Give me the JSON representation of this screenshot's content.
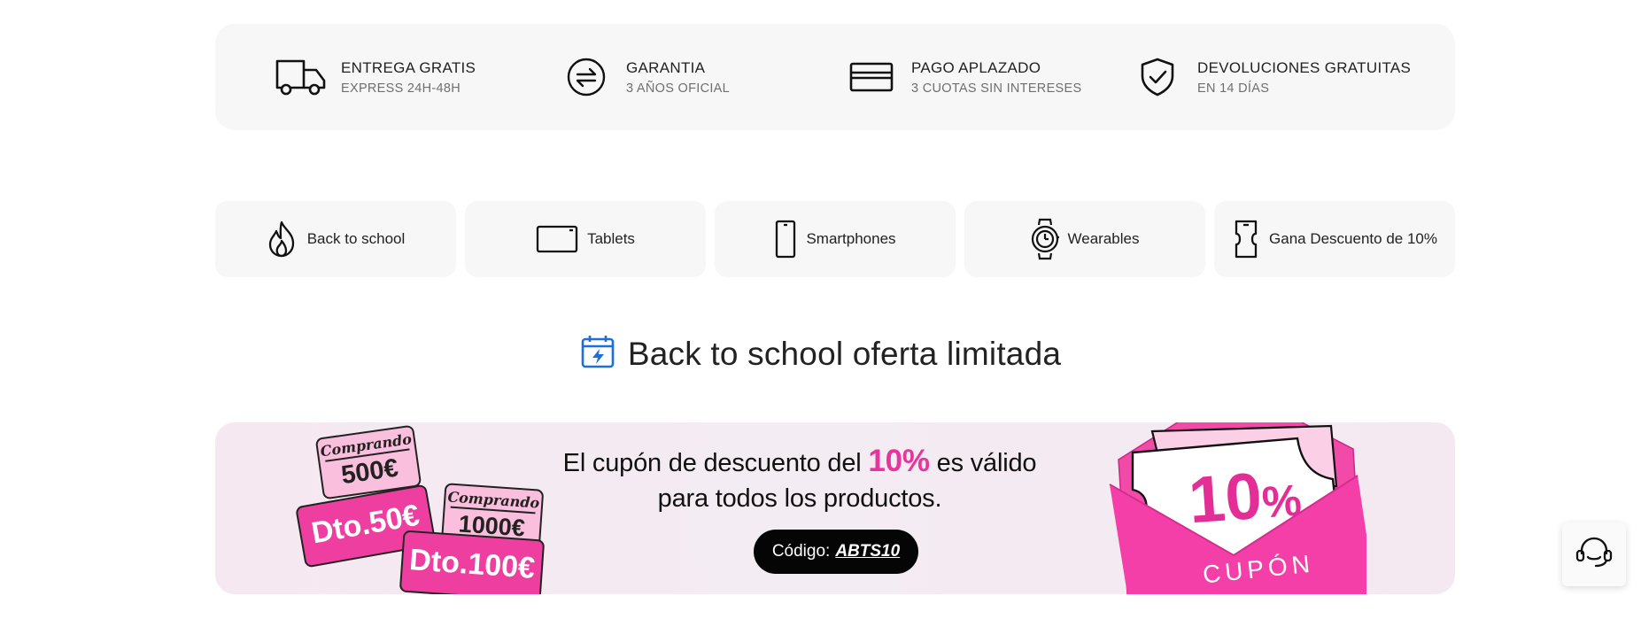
{
  "benefits": [
    {
      "icon": "truck-icon",
      "title": "ENTREGA GRATIS",
      "subtitle": "EXPRESS 24H-48H"
    },
    {
      "icon": "exchange-icon",
      "title": "GARANTIA",
      "subtitle": "3 AÑOS OFICIAL"
    },
    {
      "icon": "credit-card-icon",
      "title": "PAGO APLAZADO",
      "subtitle": "3 CUOTAS SIN INTERESES"
    },
    {
      "icon": "shield-check-icon",
      "title": "DEVOLUCIONES GRATUITAS",
      "subtitle": "EN 14 DÍAS"
    }
  ],
  "categories": [
    {
      "icon": "flame-icon",
      "label": "Back to school"
    },
    {
      "icon": "tablet-icon",
      "label": "Tablets"
    },
    {
      "icon": "smartphone-icon",
      "label": "Smartphones"
    },
    {
      "icon": "watch-icon",
      "label": "Wearables"
    },
    {
      "icon": "ticket-phone-icon",
      "label": "Gana Descuento de 10%"
    }
  ],
  "section": {
    "icon": "calendar-flash-icon",
    "title": "Back to school oferta limitada"
  },
  "banner": {
    "msg_before": "El cupón de descuento del ",
    "msg_highlight": "10%",
    "msg_after": " es válido",
    "msg_line2": "para todos los productos.",
    "code_label": "Código:",
    "code_value": "ABTS10",
    "coupons": [
      {
        "buy_label": "Comprando",
        "buy_amount": "500€",
        "discount": "Dto.50€"
      },
      {
        "buy_label": "Comprando",
        "buy_amount": "1000€",
        "discount": "Dto.100€"
      }
    ],
    "envelope_percent": "10",
    "envelope_percent_sign": "%",
    "envelope_word": "CUPÓN"
  },
  "support": {
    "icon": "headset-icon"
  },
  "colors": {
    "accent_pink": "#e7359c",
    "icon_blue": "#1e6fd9",
    "panel_bg": "#f7f7f7"
  }
}
